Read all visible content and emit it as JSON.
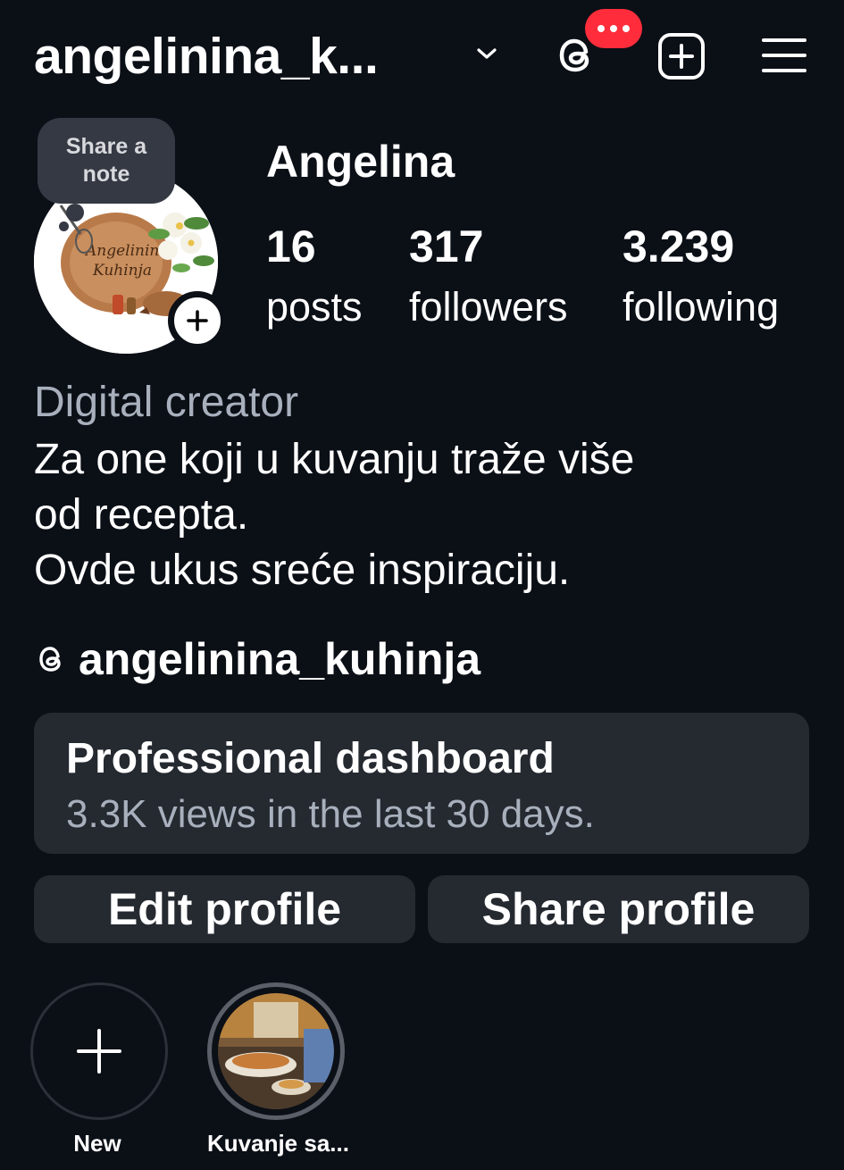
{
  "header": {
    "username": "angelinina_k...",
    "notification_badge": "•••"
  },
  "profile": {
    "note_prompt": "Share a note",
    "display_name": "Angelina",
    "stats": {
      "posts": {
        "value": "16",
        "label": "posts"
      },
      "followers": {
        "value": "317",
        "label": "followers"
      },
      "following": {
        "value": "3.239",
        "label": "following"
      }
    },
    "category": "Digital creator",
    "bio_lines": [
      "Za one koji u kuvanju traže više",
      "od recepta.",
      "Ovde ukus sreće inspiraciju."
    ],
    "threads_handle": "angelinina_kuhinja",
    "avatar_logo_text": "Angelinina Kuhinja"
  },
  "dashboard": {
    "title": "Professional dashboard",
    "subtitle": "3.3K views in the last 30 days."
  },
  "actions": {
    "edit_profile": "Edit profile",
    "share_profile": "Share profile"
  },
  "highlights": [
    {
      "label": "New"
    },
    {
      "label": "Kuvanje sa..."
    }
  ],
  "icons": {
    "chevron": "chevron-down-icon",
    "threads": "threads-icon",
    "new_post": "plus-square-icon",
    "menu": "hamburger-menu-icon",
    "add": "plus-icon"
  },
  "colors": {
    "background": "#0b0f16",
    "button_bg": "#252930",
    "secondary_text": "#a8b0bd",
    "badge_red": "#ff2d3b"
  }
}
